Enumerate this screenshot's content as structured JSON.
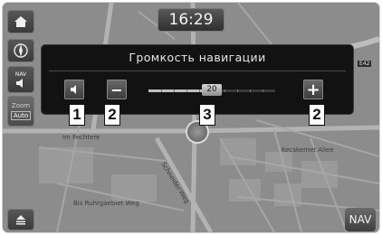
{
  "clock": {
    "time": "16:29"
  },
  "volume_panel": {
    "title": "Громкость навигации",
    "minus_label": "−",
    "plus_label": "+",
    "level": 20,
    "level_max": 40
  },
  "side_buttons": {
    "nav_label": "NAV",
    "zoom_top": "Zoom",
    "zoom_bottom": "Auto"
  },
  "bottom_right": {
    "nav_label": "NAV"
  },
  "map_labels": {
    "street_1": "Im Fechtere",
    "street_2": "Schneider-Weg",
    "street_3": "Kecskemet Allee",
    "street_4": "Bis Ruhrgaebiet Weg",
    "street_5": "",
    "road_badge": "E42"
  },
  "callouts": [
    "1",
    "2",
    "3",
    "2"
  ],
  "colors": {
    "panel_bg": "#121212",
    "map_bg": "#8f8f8f",
    "road": "#b5b5b5"
  }
}
